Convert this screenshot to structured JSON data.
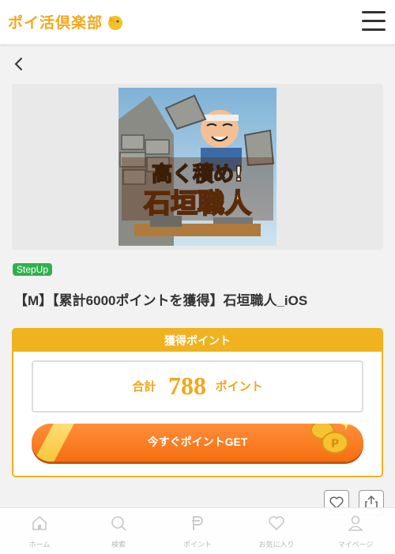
{
  "header": {
    "logo_text": "ポイ活倶楽部",
    "menu_icon": "hamburger-icon"
  },
  "nav": {
    "back_icon": "chevron-left-icon"
  },
  "banner": {
    "headline_line1": "高く積め!",
    "headline_line2": "石垣職人"
  },
  "offer": {
    "tag": "StepUp",
    "title": "【M】【累計6000ポイントを獲得】石垣職人_iOS"
  },
  "points": {
    "header": "獲得ポイント",
    "total_label": "合計",
    "total_value": "788",
    "unit": "ポイント",
    "button_label": "今すぐポイントGET",
    "button_icon": "coin-icon"
  },
  "actions": {
    "favorite_icon": "heart-icon",
    "share_icon": "share-icon"
  },
  "tabbar": {
    "items": [
      {
        "label": "ホーム",
        "icon": "home-icon"
      },
      {
        "label": "検索",
        "icon": "search-icon"
      },
      {
        "label": "ポイント",
        "icon": "point-p-icon"
      },
      {
        "label": "お気に入り",
        "icon": "heart-icon"
      },
      {
        "label": "マイページ",
        "icon": "user-icon"
      }
    ]
  },
  "colors": {
    "brand": "#f0b21e",
    "button": "#f56f10",
    "tag": "#2fb24b"
  }
}
